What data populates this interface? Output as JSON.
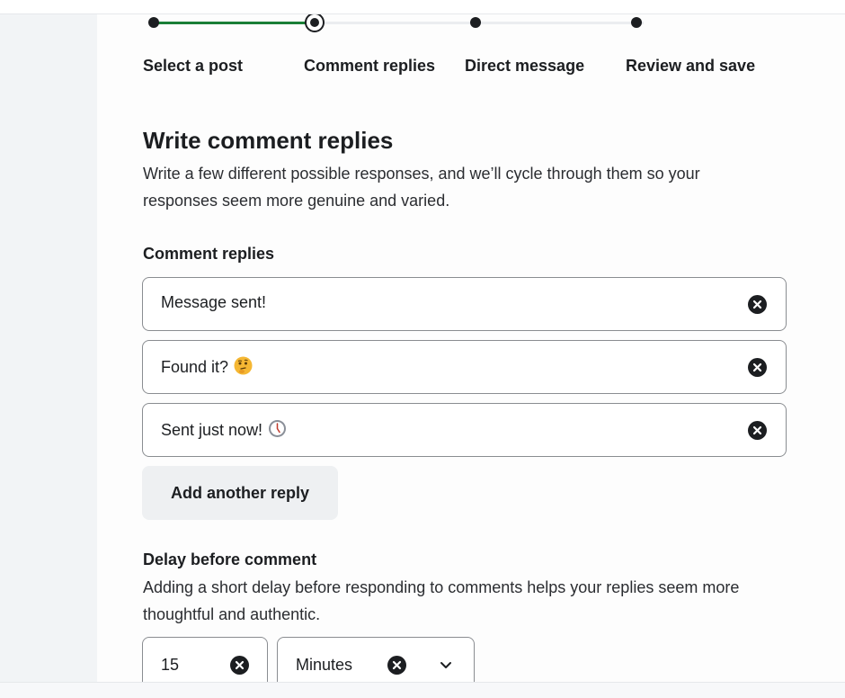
{
  "stepper": {
    "steps": [
      {
        "label": "Select a post",
        "state": "done"
      },
      {
        "label": "Comment replies",
        "state": "current"
      },
      {
        "label": "Direct message",
        "state": "upcoming"
      },
      {
        "label": "Review and save",
        "state": "upcoming"
      }
    ]
  },
  "section": {
    "title": "Write comment replies",
    "description_line1": "Write a few different possible responses, and we’ll cycle through them so your",
    "description_line2": "responses seem more genuine and varied."
  },
  "replies": {
    "label": "Comment replies",
    "items": [
      {
        "text": "Message sent!",
        "emoji": ""
      },
      {
        "text": "Found it?",
        "emoji": "thinking-face-emoji"
      },
      {
        "text": "Sent just now!",
        "emoji": "clock-emoji"
      }
    ],
    "add_button_label": "Add another reply"
  },
  "delay": {
    "label": "Delay before comment",
    "description_line1": "Adding a short delay before responding to comments helps your replies seem more",
    "description_line2": "thoughtful and authentic.",
    "amount": "15",
    "unit": "Minutes"
  },
  "colors": {
    "accent_progress": "#1a7f37",
    "text": "#1c1e21",
    "sidebar_bg": "#f2f4f6"
  }
}
